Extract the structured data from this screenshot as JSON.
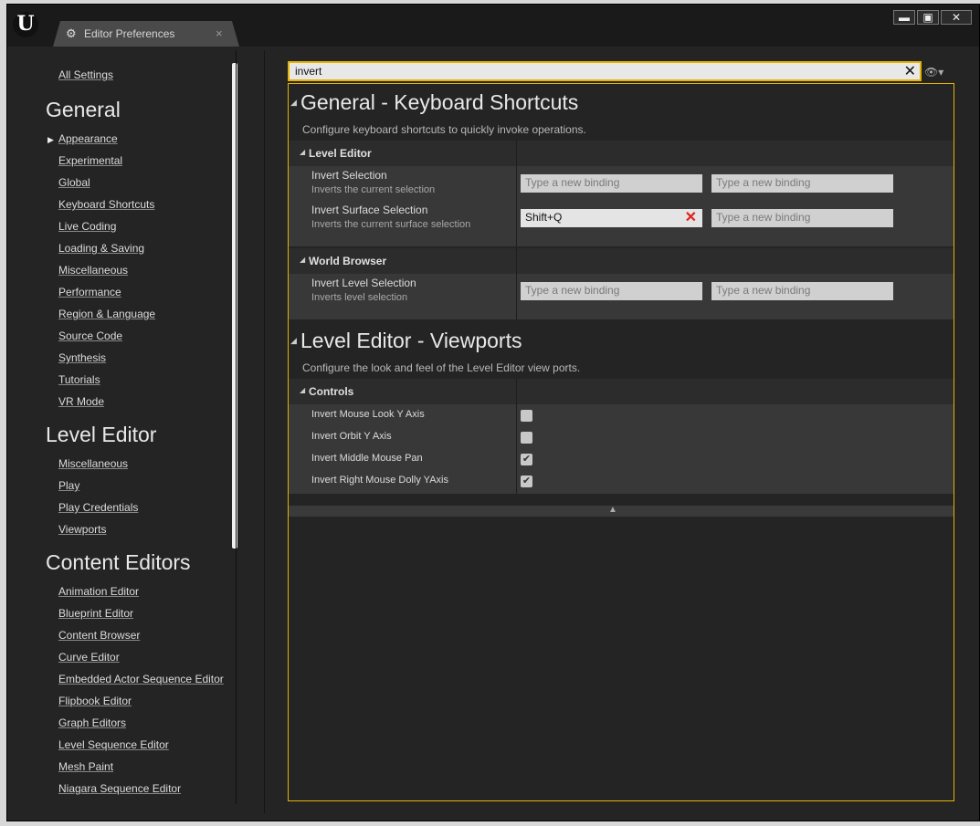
{
  "window": {
    "tab_title": "Editor Preferences",
    "tab_close": "×",
    "logo_glyph": "U",
    "tab_icon_glyph": "⚙",
    "buttons": {
      "minimize": "▬",
      "maximize": "▣",
      "close": "✕"
    }
  },
  "sidebar": {
    "all_settings": "All Settings",
    "general": {
      "heading": "General",
      "items": [
        "Appearance",
        "Experimental",
        "Global",
        "Keyboard Shortcuts",
        "Live Coding",
        "Loading & Saving",
        "Miscellaneous",
        "Performance",
        "Region & Language",
        "Source Code",
        "Synthesis",
        "Tutorials",
        "VR Mode"
      ]
    },
    "level_editor": {
      "heading": "Level Editor",
      "items": [
        "Miscellaneous",
        "Play",
        "Play Credentials",
        "Viewports"
      ]
    },
    "content_editors": {
      "heading": "Content Editors",
      "items": [
        "Animation Editor",
        "Blueprint Editor",
        "Content Browser",
        "Curve Editor",
        "Embedded Actor Sequence Editor",
        "Flipbook Editor",
        "Graph Editors",
        "Level Sequence Editor",
        "Mesh Paint",
        "Niagara Sequence Editor"
      ]
    }
  },
  "search": {
    "value": "invert",
    "clear": "✕",
    "eye": "👁▾"
  },
  "sections": [
    {
      "title": "General - Keyboard Shortcuts",
      "description": "Configure keyboard shortcuts to quickly invoke operations.",
      "categories": [
        {
          "name": "Level Editor",
          "props": [
            {
              "name": "Invert Selection",
              "desc": "Inverts the current selection",
              "b1": "",
              "b2": ""
            },
            {
              "name": "Invert Surface Selection",
              "desc": "Inverts the current surface selection",
              "b1": "Shift+Q",
              "b2": ""
            }
          ]
        },
        {
          "name": "World Browser",
          "props": [
            {
              "name": "Invert Level Selection",
              "desc": "Inverts level selection",
              "b1": "",
              "b2": ""
            }
          ]
        }
      ]
    },
    {
      "title": "Level Editor - Viewports",
      "description": "Configure the look and feel of the Level Editor view ports.",
      "categories": [
        {
          "name": "Controls",
          "props": [
            {
              "name": "Invert Mouse Look Y Axis",
              "checked": false
            },
            {
              "name": "Invert Orbit Y Axis",
              "checked": false
            },
            {
              "name": "Invert Middle Mouse Pan",
              "checked": true
            },
            {
              "name": "Invert Right Mouse Dolly YAxis",
              "checked": true
            }
          ]
        }
      ]
    }
  ],
  "binding_placeholder": "Type a new binding",
  "glyphs": {
    "expanded": "◢",
    "collapsed_arrow": "▶",
    "check": "✔",
    "remove": "✕",
    "collapse": "▲"
  }
}
